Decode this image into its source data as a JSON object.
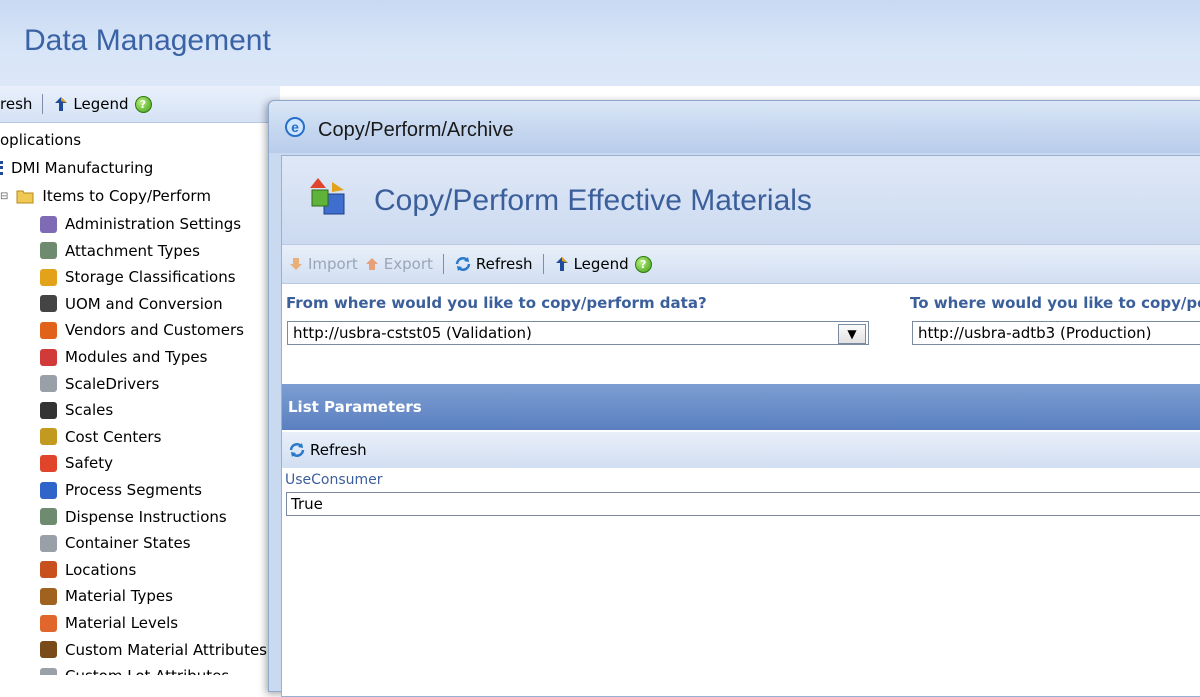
{
  "app": {
    "title": "Data Management"
  },
  "left_toolbar": {
    "refresh_label": "resh",
    "legend_label": "Legend"
  },
  "tree": {
    "root": "oplications",
    "dmi": "DMI Manufacturing",
    "folder": "Items to Copy/Perform",
    "items": [
      {
        "label": "Administration Settings",
        "icon": "settings-icon",
        "color": "#7f6bb5"
      },
      {
        "label": "Attachment Types",
        "icon": "document-icon",
        "color": "#6f8b6f"
      },
      {
        "label": "Storage Classifications",
        "icon": "box-icon",
        "color": "#e2a21a"
      },
      {
        "label": "UOM and Conversion",
        "icon": "weights-icon",
        "color": "#444444"
      },
      {
        "label": "Vendors and Customers",
        "icon": "people-icon",
        "color": "#e0621b"
      },
      {
        "label": "Modules and Types",
        "icon": "modules-icon",
        "color": "#d23a3a"
      },
      {
        "label": "ScaleDrivers",
        "icon": "gears-icon",
        "color": "#9aa0a8"
      },
      {
        "label": "Scales",
        "icon": "scale-icon",
        "color": "#333333"
      },
      {
        "label": "Cost Centers",
        "icon": "money-icon",
        "color": "#c29a1f"
      },
      {
        "label": "Safety",
        "icon": "shield-icon",
        "color": "#e0452c"
      },
      {
        "label": "Process Segments",
        "icon": "segments-icon",
        "color": "#2f64c8"
      },
      {
        "label": "Dispense Instructions",
        "icon": "document-icon",
        "color": "#6f8b6f"
      },
      {
        "label": "Container States",
        "icon": "gears-icon",
        "color": "#9aa0a8"
      },
      {
        "label": "Locations",
        "icon": "truck-icon",
        "color": "#c8501f"
      },
      {
        "label": "Material Types",
        "icon": "pot-icon",
        "color": "#a0631f"
      },
      {
        "label": "Material Levels",
        "icon": "pin-icon",
        "color": "#e0662c"
      },
      {
        "label": "Custom Material Attributes",
        "icon": "leaf-icon",
        "color": "#7a4b1a"
      },
      {
        "label": "Custom Lot Attributes",
        "icon": "gears-icon",
        "color": "#9aa0a8"
      }
    ]
  },
  "modal": {
    "title": "Copy/Perform/Archive",
    "header": "Copy/Perform Effective Materials",
    "toolbar": {
      "import": "Import",
      "export": "Export",
      "refresh": "Refresh",
      "legend": "Legend"
    },
    "from_label": "From where would you like to copy/perform data?",
    "from_value": "http://usbra-cstst05  (Validation)",
    "to_label": "To where would you like to copy/pe",
    "to_value": "http://usbra-adtb3  (Production)",
    "list_params": "List Parameters",
    "params_refresh": "Refresh",
    "param_name": "UseConsumer",
    "param_value": "True"
  }
}
